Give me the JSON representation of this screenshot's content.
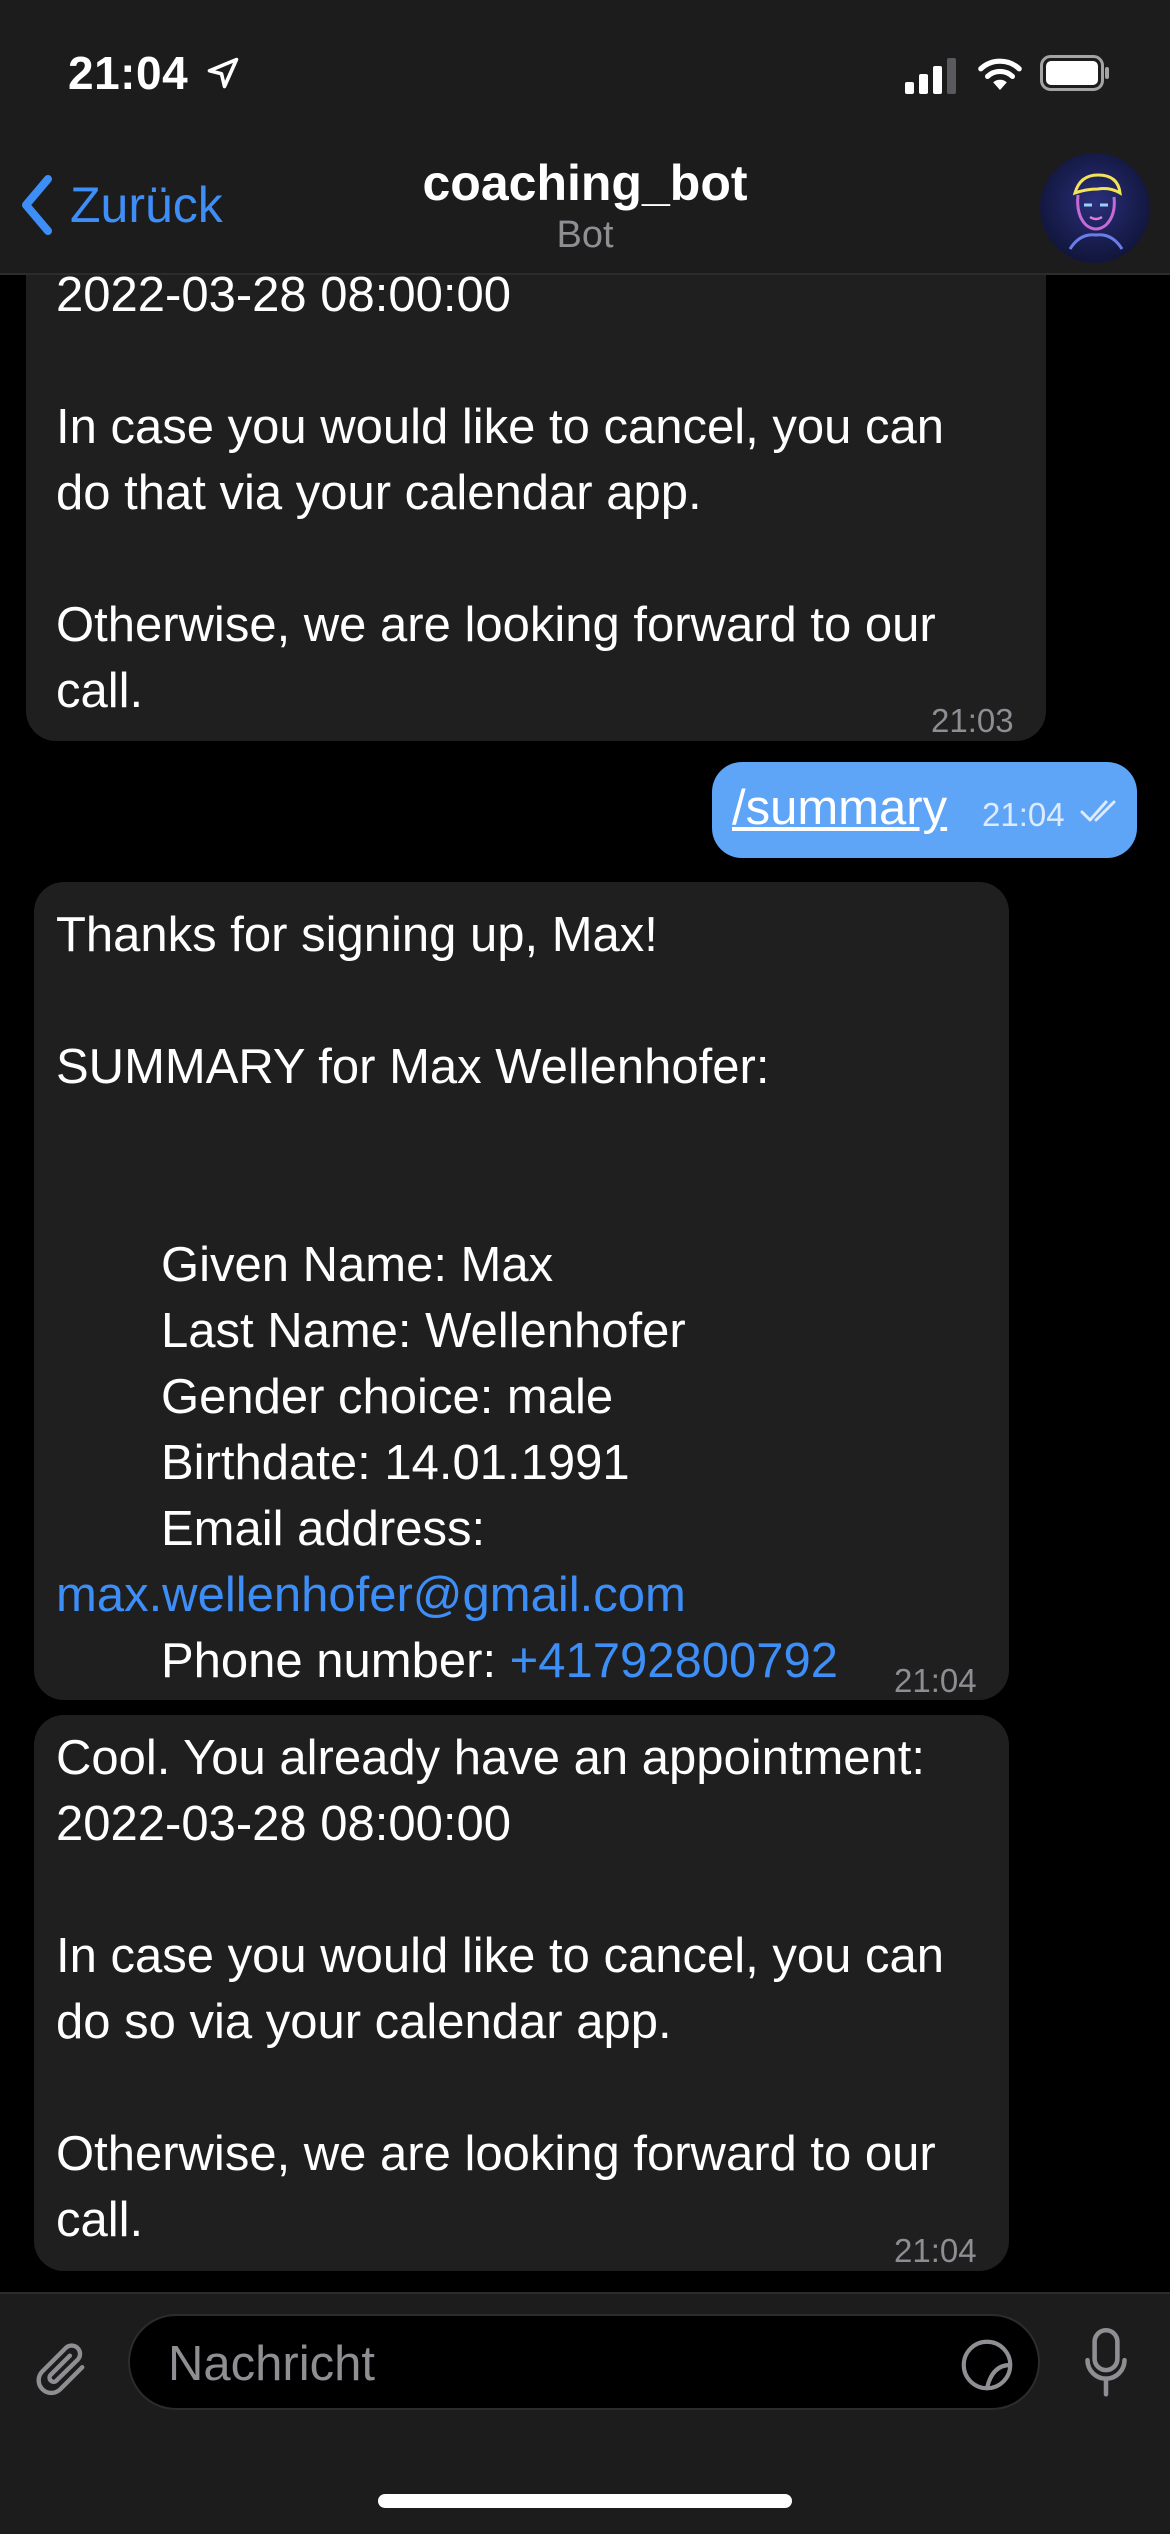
{
  "status_bar": {
    "time": "21:04"
  },
  "header": {
    "back_label": "Zurück",
    "title": "coaching_bot",
    "subtitle": "Bot"
  },
  "messages": {
    "first": {
      "lines": [
        "2022-03-28 08:00:00",
        "",
        "In case you would like to cancel, you can",
        "do that via your calendar app.",
        "",
        "Otherwise, we are looking forward to our",
        "call."
      ],
      "time": "21:03"
    },
    "outgoing": {
      "text": "/summary",
      "time": "21:04"
    },
    "summary": {
      "l1": "Thanks for signing up, Max!",
      "l2": "SUMMARY for Max Wellenhofer:",
      "given": "Given Name:  Max",
      "last": "Last Name:  Wellenhofer",
      "gender": "Gender choice:  male",
      "birth": "Birthdate:   14.01.1991",
      "email_label": "Email address:",
      "email": "max.wellenhofer@gmail.com",
      "phone_label": "Phone number: ",
      "phone": "+41792800792",
      "time": "21:04"
    },
    "last": {
      "l1": "Cool. You already have an appointment:",
      "l2": "2022-03-28 08:00:00",
      "l3": "In case you would like to cancel, you can",
      "l4": "do so via your calendar app.",
      "l5": "Otherwise, we are looking forward to our",
      "l6": "call.",
      "time": "21:04"
    }
  },
  "composer": {
    "placeholder": "Nachricht"
  },
  "colors": {
    "accent": "#3e8ef7",
    "outgoing_bubble": "#5ea5f8",
    "incoming_bubble": "#1f1f1f"
  }
}
